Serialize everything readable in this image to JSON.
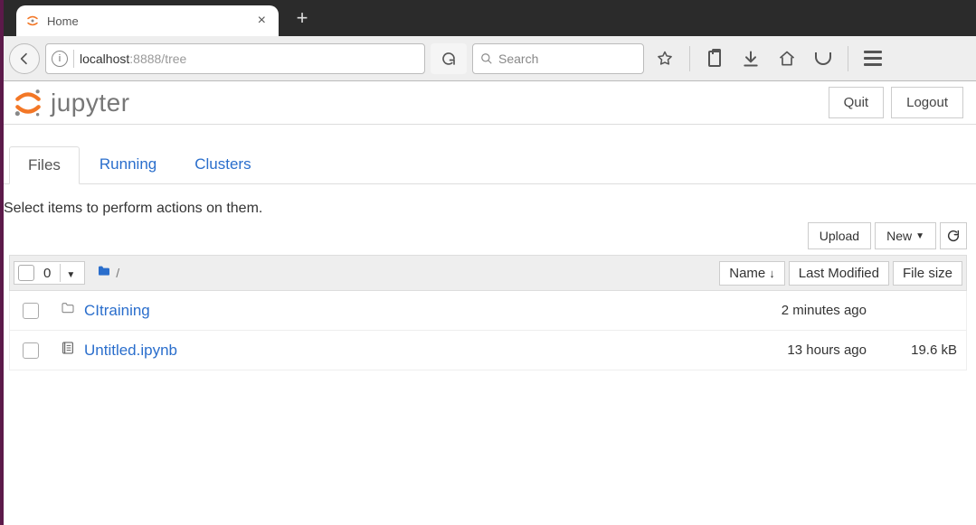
{
  "browser": {
    "tab_title": "Home",
    "url_host": "localhost",
    "url_rest": ":8888/tree",
    "search_placeholder": "Search"
  },
  "header": {
    "brand": "jupyter",
    "quit_label": "Quit",
    "logout_label": "Logout"
  },
  "tabs": {
    "files": "Files",
    "running": "Running",
    "clusters": "Clusters"
  },
  "instruction": "Select items to perform actions on them.",
  "toolbar": {
    "upload": "Upload",
    "new": "New",
    "selected_count": "0",
    "breadcrumb_sep": "/"
  },
  "columns": {
    "name": "Name",
    "modified": "Last Modified",
    "size": "File size"
  },
  "rows": [
    {
      "type": "folder",
      "name": "CItraining",
      "modified": "2 minutes ago",
      "size": ""
    },
    {
      "type": "notebook",
      "name": "Untitled.ipynb",
      "modified": "13 hours ago",
      "size": "19.6 kB"
    }
  ]
}
